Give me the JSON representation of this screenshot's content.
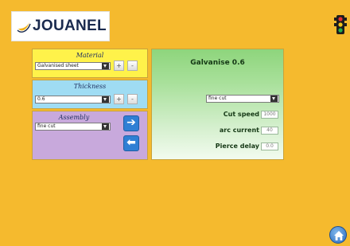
{
  "brand": {
    "name": "JOUANEL",
    "logo_icon": "jouanel-swoosh-icon",
    "accent": "#1a2a4e"
  },
  "status": {
    "icon": "traffic-light-icon",
    "colors": [
      "#e53030",
      "#f2c51b",
      "#23b14d"
    ]
  },
  "material": {
    "label": "Material",
    "selected": "Galvanised sheet",
    "add_label": "+",
    "remove_label": "-"
  },
  "thickness": {
    "label": "Thickness",
    "selected": "0.6",
    "add_label": "+",
    "remove_label": "-"
  },
  "assembly": {
    "label": "Assembly",
    "selected": "fine cut"
  },
  "navigation": {
    "forward_icon": "arrow-right-icon",
    "back_icon": "arrow-left-icon",
    "forward_glyph": "➔",
    "back_glyph": "⬅"
  },
  "settings": {
    "title": "Galvanise 0.6",
    "mode_selected": "fine cut",
    "params": [
      {
        "label": "Cut speed",
        "value": "1000"
      },
      {
        "label": "arc current",
        "value": "40"
      },
      {
        "label": "Pierce delay",
        "value": "0.0"
      }
    ]
  },
  "home": {
    "icon": "home-icon"
  },
  "colors": {
    "background": "#f5ba2e",
    "material_panel": "#fff24a",
    "thickness_panel": "#9fdcf3",
    "assembly_panel": "#c8a9dc",
    "settings_panel": "#8ed57c",
    "arrow_button": "#2f7fd4"
  }
}
